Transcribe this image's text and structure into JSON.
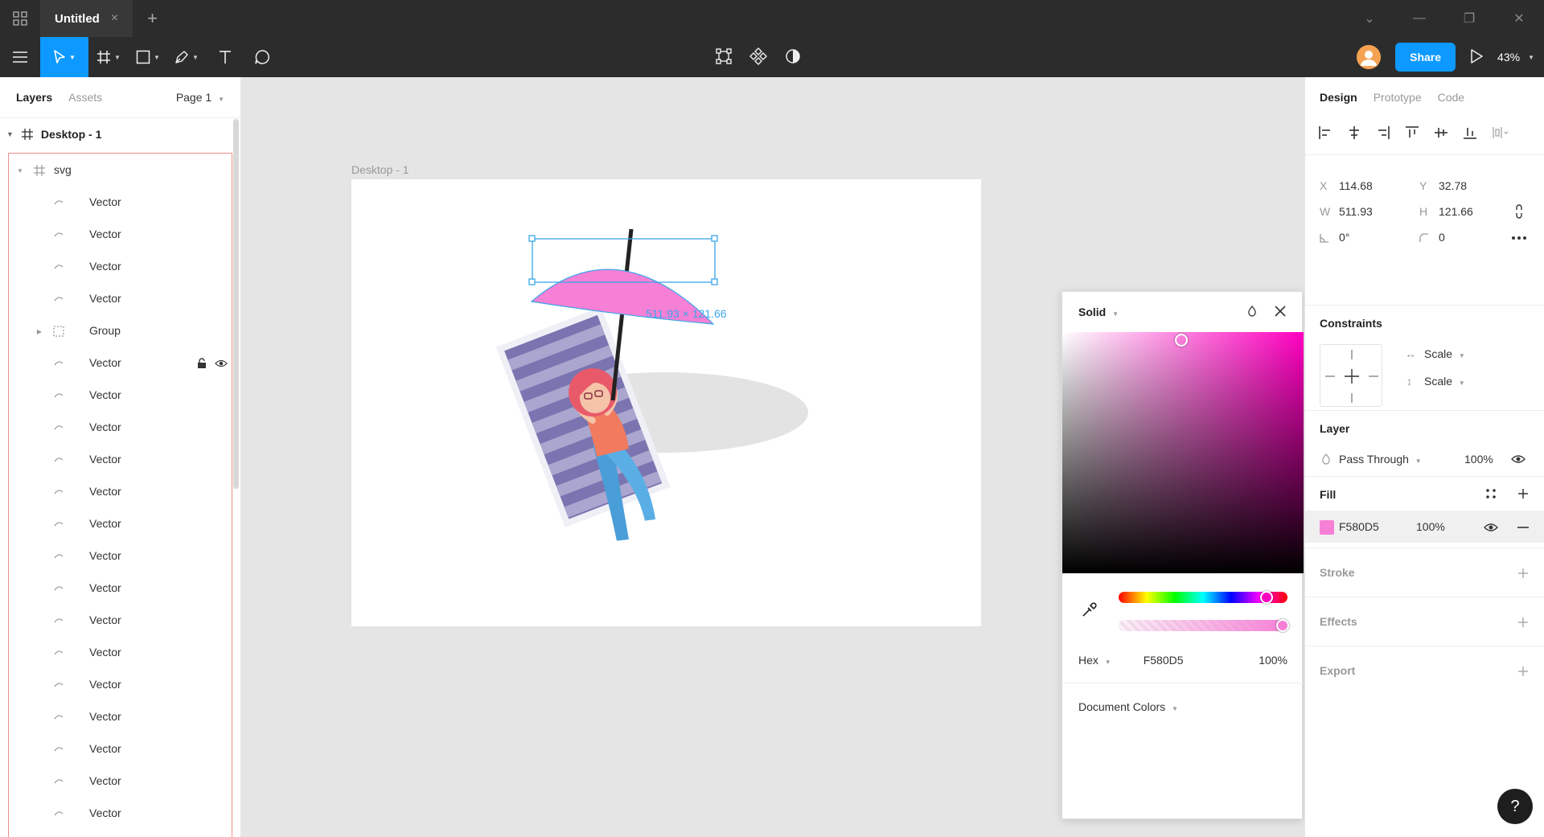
{
  "titlebar": {
    "tab_title": "Untitled",
    "tab_close": "×",
    "new_tab": "+",
    "minimize": "—",
    "restore": "❐",
    "close": "✕",
    "menu_caret": "⌄"
  },
  "toolbar": {
    "share_label": "Share",
    "zoom_label": "43%"
  },
  "left_panel": {
    "tab_layers": "Layers",
    "tab_assets": "Assets",
    "page_label": "Page 1",
    "frame_name": "Desktop - 1",
    "layers": [
      {
        "name": "svg",
        "icon": "frame-icon"
      },
      {
        "name": "Vector",
        "icon": "vector-icon"
      },
      {
        "name": "Vector",
        "icon": "vector-icon"
      },
      {
        "name": "Vector",
        "icon": "vector-icon"
      },
      {
        "name": "Vector",
        "icon": "vector-icon"
      },
      {
        "name": "Group",
        "icon": "group-icon"
      },
      {
        "name": "Vector",
        "icon": "vector-icon"
      },
      {
        "name": "Vector",
        "icon": "vector-icon"
      },
      {
        "name": "Vector",
        "icon": "vector-icon"
      },
      {
        "name": "Vector",
        "icon": "vector-icon"
      },
      {
        "name": "Vector",
        "icon": "vector-icon"
      },
      {
        "name": "Vector",
        "icon": "vector-icon"
      },
      {
        "name": "Vector",
        "icon": "vector-icon"
      },
      {
        "name": "Vector",
        "icon": "vector-icon"
      },
      {
        "name": "Vector",
        "icon": "vector-icon"
      },
      {
        "name": "Vector",
        "icon": "vector-icon"
      },
      {
        "name": "Vector",
        "icon": "vector-icon"
      },
      {
        "name": "Vector",
        "icon": "vector-icon"
      },
      {
        "name": "Vector",
        "icon": "vector-icon"
      },
      {
        "name": "Vector",
        "icon": "vector-icon"
      },
      {
        "name": "Vector",
        "icon": "vector-icon"
      }
    ]
  },
  "canvas": {
    "frame_label": "Desktop - 1",
    "selection_dims": "511.93 × 121.66"
  },
  "color_picker": {
    "mode": "Solid",
    "format": "Hex",
    "hex": "F580D5",
    "opacity": "100%",
    "document_colors": "Document Colors",
    "color": "#F580D5"
  },
  "right_panel": {
    "tab_design": "Design",
    "tab_prototype": "Prototype",
    "tab_code": "Code",
    "x_label": "X",
    "x_value": "114.68",
    "y_label": "Y",
    "y_value": "32.78",
    "w_label": "W",
    "w_value": "511.93",
    "h_label": "H",
    "h_value": "121.66",
    "rotation_value": "0°",
    "radius_value": "0",
    "constraints_title": "Constraints",
    "constraint_h": "Scale",
    "constraint_v": "Scale",
    "layer_title": "Layer",
    "blend_mode": "Pass Through",
    "layer_opacity": "100%",
    "fill_title": "Fill",
    "fill_hex": "F580D5",
    "fill_opacity": "100%",
    "stroke_title": "Stroke",
    "effects_title": "Effects",
    "export_title": "Export"
  },
  "help_label": "?"
}
